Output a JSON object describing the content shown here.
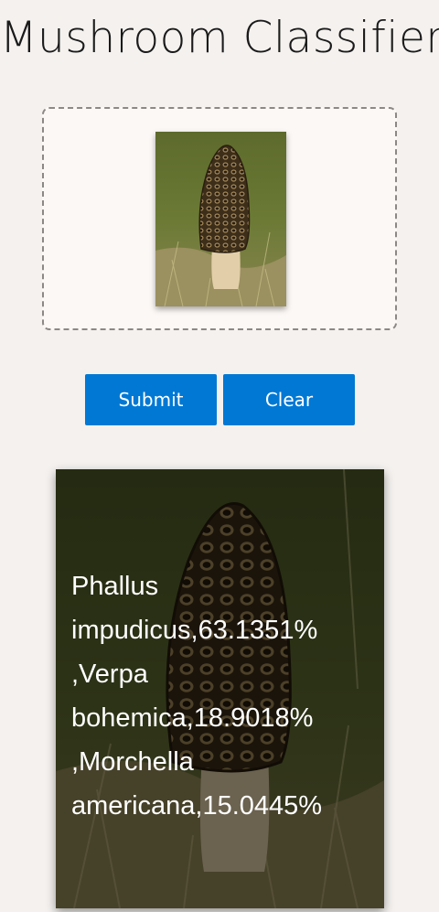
{
  "app": {
    "title": "Mushroom Classifier"
  },
  "upload": {
    "image_subject": "morel-mushroom-photo"
  },
  "actions": {
    "submit_label": "Submit",
    "clear_label": "Clear"
  },
  "result": {
    "text": "Phallus impudicus,63.1351% ,Verpa bohemica,18.9018% ,Morchella americana,15.0445%",
    "predictions": [
      {
        "name": "Phallus impudicus",
        "confidence": "63.1351%"
      },
      {
        "name": "Verpa bohemica",
        "confidence": "18.9018%"
      },
      {
        "name": "Morchella americana",
        "confidence": "15.0445%"
      }
    ]
  },
  "colors": {
    "accent": "#0078d4",
    "background": "#f4f1ef",
    "dropzone_bg": "#fcf8f6"
  }
}
